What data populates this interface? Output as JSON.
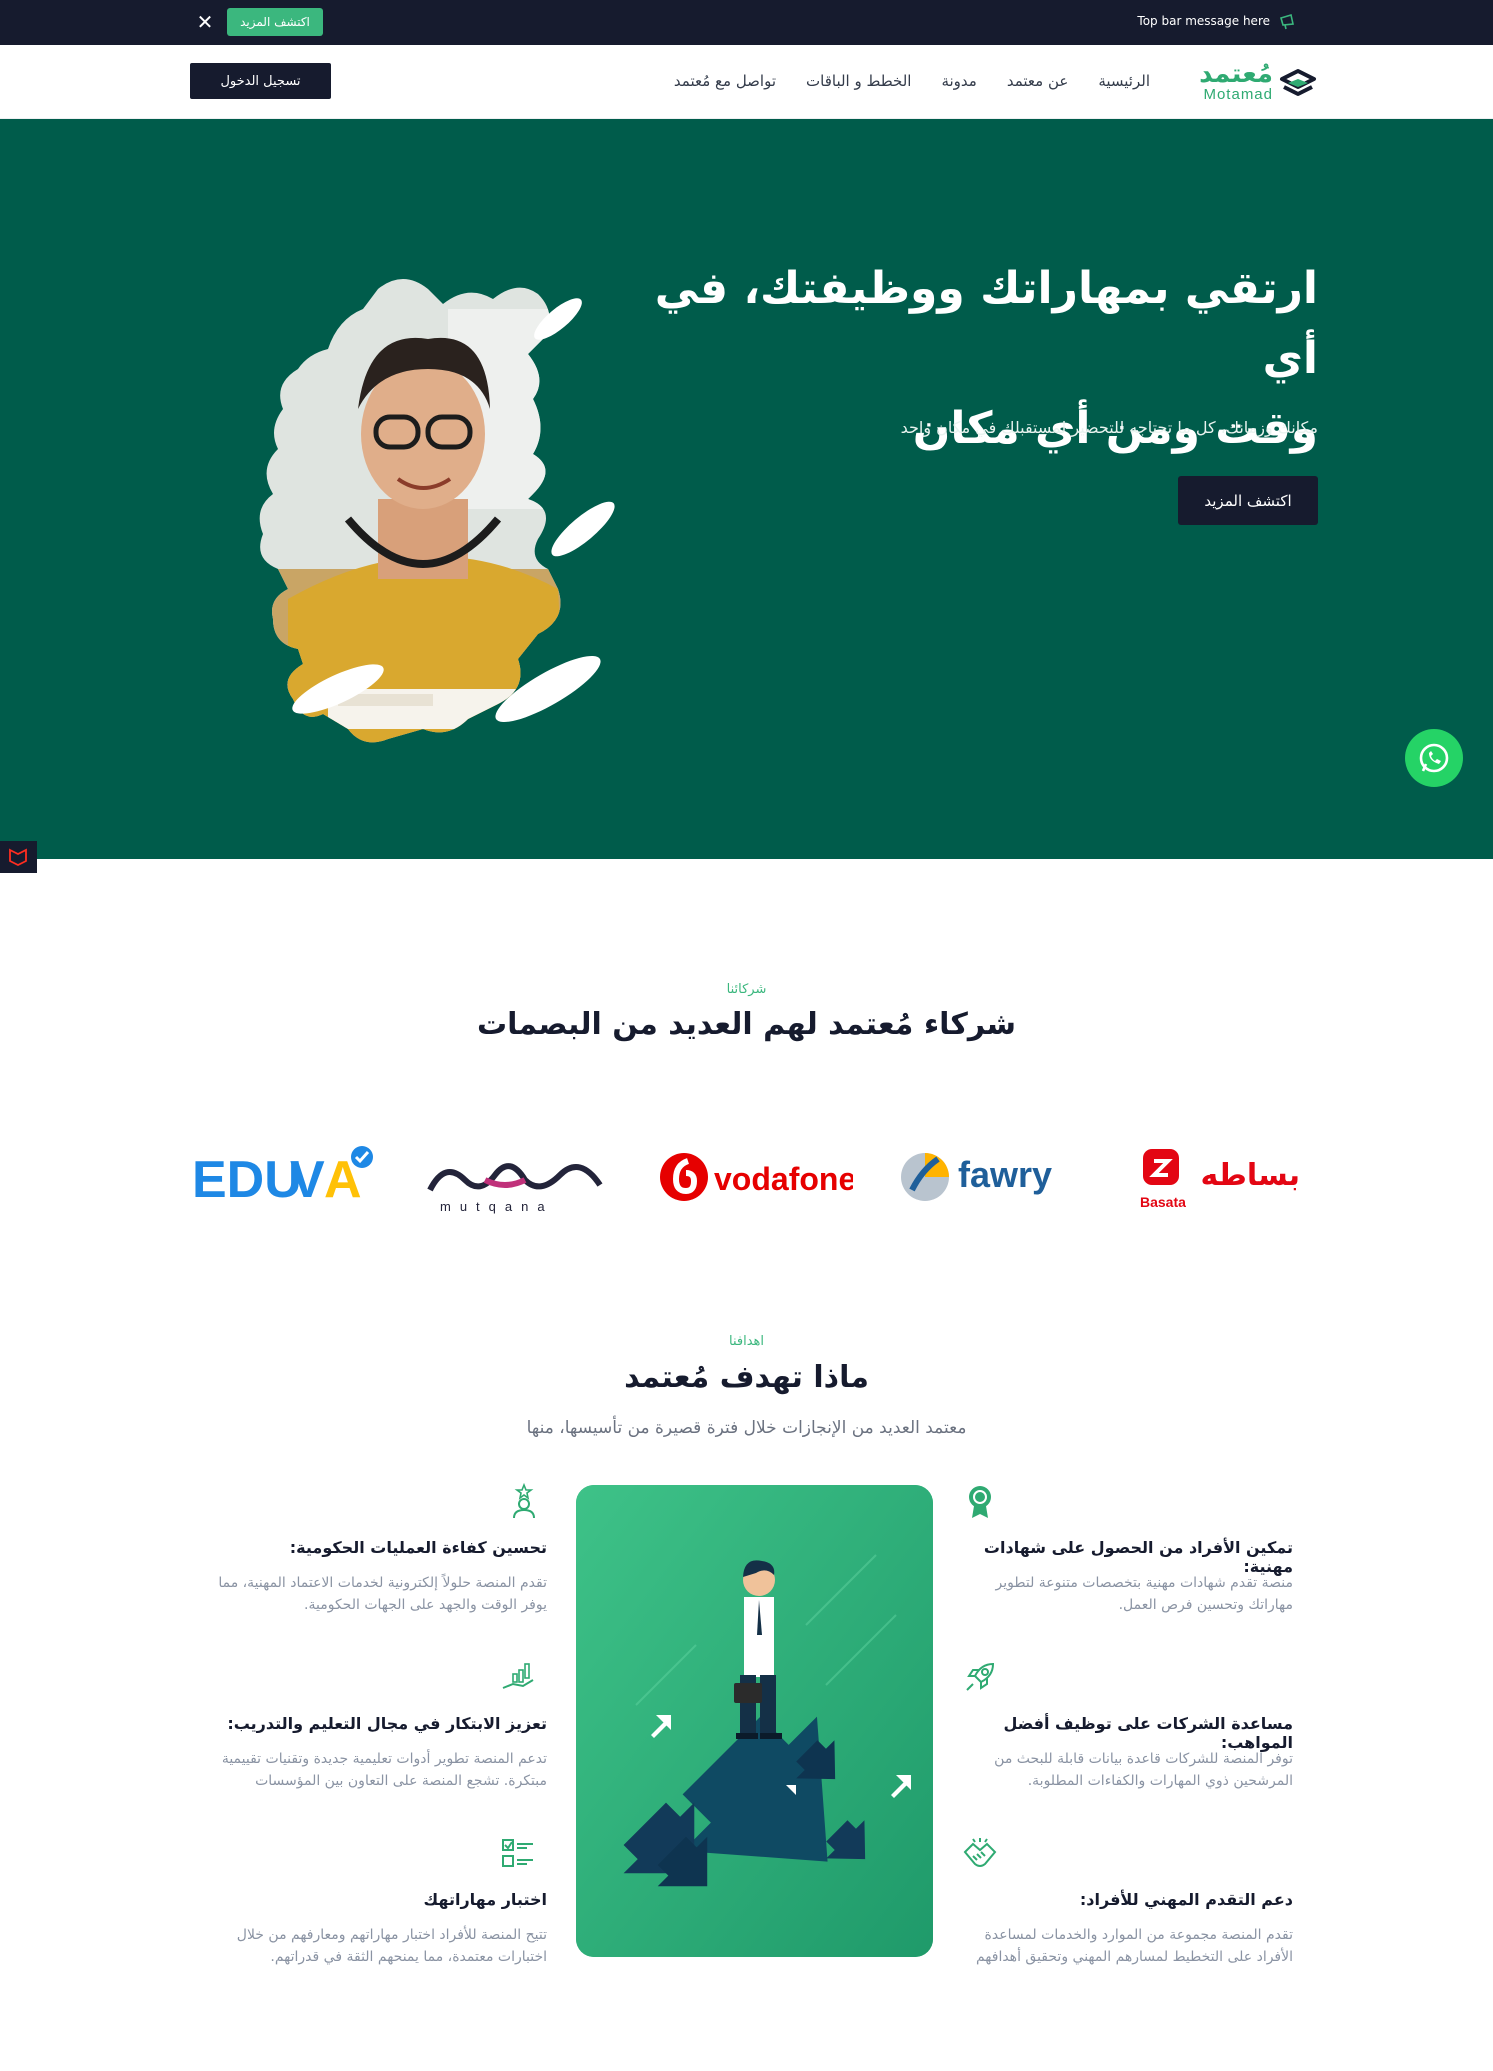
{
  "topbar": {
    "message": "Top bar message here",
    "button_label": "اكتشف المزيد",
    "close_icon": "close-icon"
  },
  "header": {
    "logo_ar": "مُعتمد",
    "logo_en": "Motamad",
    "nav": [
      "الرئيسية",
      "عن معتمد",
      "مدونة",
      "الخطط و الباقات",
      "تواصل مع مُعتمد"
    ],
    "login_label": "تسجيل الدخول"
  },
  "hero": {
    "title_line1": "ارتقي بمهاراتك ووظيفتك، في أي",
    "title_line2": "وقت ومن أي مكان",
    "subtitle": "مكانك وزمانك، كل ما تحتاجه للتحضير لمستقبلك في مكان واحد",
    "button_label": "اكتشف المزيد"
  },
  "partners": {
    "eyebrow": "شركائنا",
    "title": "شركاء مُعتمد لهم العديد من البصمات",
    "logos": [
      {
        "name": "EDUVA",
        "color": "#1e88e5"
      },
      {
        "name": "mutqana",
        "color": "#23243a"
      },
      {
        "name": "vodafone",
        "color": "#e60000"
      },
      {
        "name": "fawry",
        "color": "#1f5f9a"
      },
      {
        "name": "Basata",
        "color": "#e30613",
        "ar": "بساطه"
      }
    ]
  },
  "goals": {
    "eyebrow": "اهدافنا",
    "title": "ماذا تهدف مُعتمد",
    "description": "معتمد العديد من الإنجازات خلال فترة قصيرة من تأسيسها، منها",
    "right_items": [
      {
        "title": "تمكين الأفراد من الحصول على شهادات مهنية:",
        "text": "منصة تقدم شهادات مهنية بتخصصات متنوعة لتطوير مهاراتك وتحسين فرص العمل."
      },
      {
        "title": "مساعدة الشركات على توظيف أفضل المواهب:",
        "text": "توفر المنصة للشركات قاعدة بيانات قابلة للبحث من المرشحين ذوي المهارات والكفاءات المطلوبة."
      },
      {
        "title": "دعم التقدم المهني للأفراد:",
        "text": "تقدم المنصة مجموعة من الموارد والخدمات لمساعدة الأفراد على التخطيط لمسارهم المهني وتحقيق أهدافهم"
      }
    ],
    "left_items": [
      {
        "title": "تحسين كفاءة العمليات الحكومية:",
        "text": "تقدم المنصة حلولاً إلكترونية لخدمات الاعتماد المهنية، مما يوفر الوقت والجهد على الجهات الحكومية."
      },
      {
        "title": "تعزيز الابتكار في مجال التعليم والتدريب:",
        "text": "تدعم المنصة تطوير أدوات تعليمية جديدة وتقنيات تقييمية مبتكرة. تشجع المنصة على التعاون بين المؤسسات"
      },
      {
        "title": "اختبار مهاراتهك",
        "text": "تتيح المنصة للأفراد اختبار مهاراتهم ومعارفهم من خلال اختبارات معتمدة، مما يمنحهم الثقة في قدراتهم."
      }
    ]
  },
  "colors": {
    "brand_green": "#2faa72",
    "hero_green": "#005c4b",
    "dark_navy": "#161b2e"
  }
}
